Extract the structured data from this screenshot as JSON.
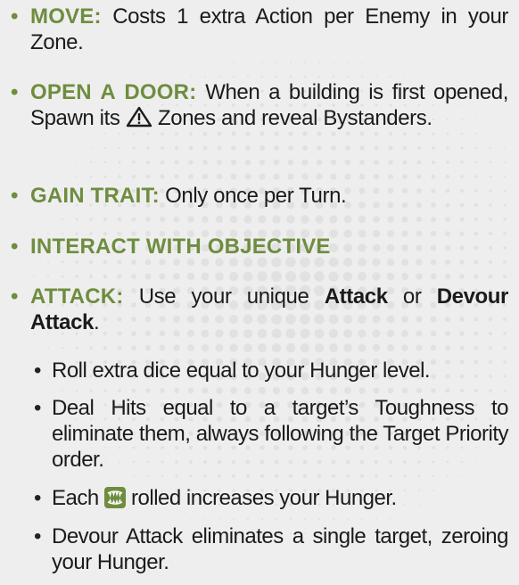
{
  "rules": {
    "move": {
      "keyword": "MOVE:",
      "text": " Costs 1 extra Action per Enemy in your Zone."
    },
    "open_door": {
      "keyword": "OPEN A DOOR:",
      "text_before_icon": " When a building is first opened, Spawn its ",
      "icon": "warning-triangle-icon",
      "text_after_icon": " Zones and reveal Bystanders."
    },
    "gain_trait": {
      "keyword": "GAIN TRAIT:",
      "text": " Only once per Turn."
    },
    "interact": {
      "keyword": "INTERACT WITH OBJECTIVE"
    },
    "attack": {
      "keyword": "ATTACK:",
      "text1": " Use your unique ",
      "bold1": "Attack",
      "text2": " or ",
      "bold2": "Devour Attack",
      "text3": ".",
      "subitems": {
        "roll": "Roll extra dice equal to your Hunger level.",
        "deal_hits": "Deal Hits equal to a target’s Toughness to eliminate them, always following the Target Priority order.",
        "each_before_icon": "Each ",
        "each_icon": "hunger-fangs-icon",
        "each_after_icon": " rolled increases your Hunger.",
        "devour": "Devour Attack eliminates a single target, zeroing your Hunger."
      }
    }
  },
  "bullet_char": "•",
  "sub_bullet_char": "•",
  "colors": {
    "keyword": "#6e8d3f",
    "text": "#1b1b1b",
    "background": "#efeeee"
  }
}
